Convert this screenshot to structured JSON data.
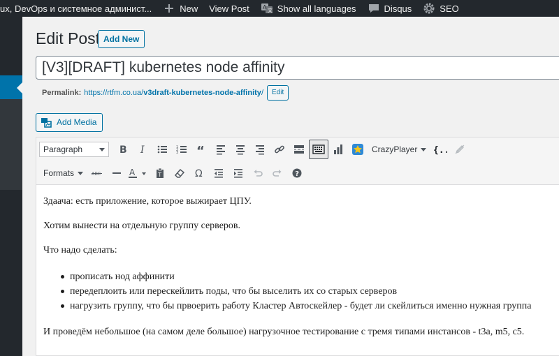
{
  "adminbar": {
    "site_name": "ux, DevOps и системное админист...",
    "new": "New",
    "view_post": "View Post",
    "show_languages": "Show all languages",
    "disqus": "Disqus",
    "seo": "SEO"
  },
  "header": {
    "title": "Edit Post",
    "add_new": "Add New"
  },
  "post_title": "[V3][DRAFT] kubernetes node affinity",
  "permalink": {
    "label": "Permalink:",
    "base": "https://rtfm.co.ua/",
    "slug": "v3draft-kubernetes-node-affinity",
    "trail": "/",
    "edit": "Edit"
  },
  "add_media": "Add Media",
  "toolbar": {
    "paragraph": "Paragraph",
    "crazyplayer": "CrazyPlayer",
    "formats": "Formats"
  },
  "content": {
    "p1": "Здаача: есть приложение, которое выжирает ЦПУ.",
    "p2": "Хотим вынести на отдельную группу серверов.",
    "p3": "Что надо сделать:",
    "items": [
      "прописать нод аффинити",
      "передеплоить или перескейлить поды, что бы выселить их со старых серверов",
      "нагрузить группу, что бы првоерить работу Кластер Автоскейлер - будет ли скейлиться именно нужная группа"
    ],
    "p4": "И проведём небольшое (на самом деле большое) нагрузочное тестирование с тремя типами инстансов - t3a, m5, c5."
  },
  "colors": {
    "adminbar": "#23282d",
    "accent": "#0073aa",
    "editor_bg": "#ffffff"
  }
}
